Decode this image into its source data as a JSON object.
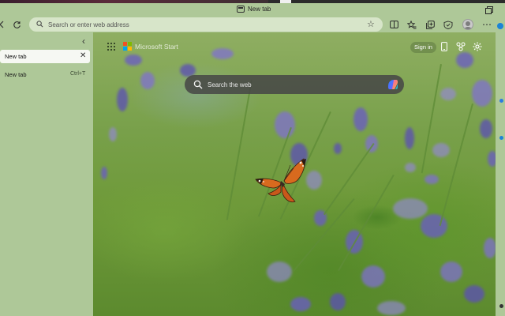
{
  "window": {
    "title": "New tab"
  },
  "toolbar": {
    "address_placeholder": "Search or enter web address",
    "icons": [
      "back-icon",
      "refresh-icon",
      "search-icon",
      "favorite-star-icon",
      "split-screen-icon",
      "favorites-icon",
      "collections-icon",
      "browser-essentials-icon",
      "profile-avatar-icon",
      "more-icon"
    ]
  },
  "sidebar": {
    "tabs": [
      {
        "label": "New tab",
        "close_glyph": "✕"
      }
    ],
    "new_tab": {
      "label": "New tab",
      "shortcut": "Ctrl+T"
    }
  },
  "newtab_page": {
    "brand": "Microsoft Start",
    "signin_label": "Sign in",
    "search_placeholder": "Search the web"
  },
  "colors": {
    "chrome": "#aec898",
    "address_bar": "#d7e5c9",
    "search_box": "#464646",
    "active_tab": "#f6f8f3"
  }
}
